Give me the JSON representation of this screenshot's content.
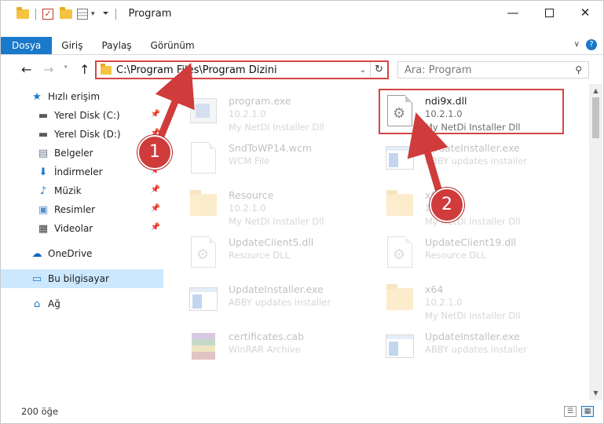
{
  "window": {
    "title": "Program",
    "minimize_glyph": "—",
    "close_glyph": "✕"
  },
  "ribbon": {
    "tabs": [
      "Dosya",
      "Giriş",
      "Paylaş",
      "Görünüm"
    ],
    "help_glyph": "?"
  },
  "nav": {
    "back_glyph": "←",
    "forward_glyph": "→",
    "recent_glyph": "˅",
    "up_glyph": "↑",
    "address_path": "C:\\Program Files\\Program Dizini",
    "refresh_glyph": "↻",
    "search_placeholder": "Ara: Program",
    "search_glyph": "⚲"
  },
  "sidebar": {
    "items": [
      {
        "label": "Hızlı erişim",
        "icon": "star-icon",
        "pinned": false
      },
      {
        "label": "Yerel Disk (C:)",
        "icon": "drive-icon",
        "pinned": true
      },
      {
        "label": "Yerel Disk (D:)",
        "icon": "drive-icon",
        "pinned": true
      },
      {
        "label": "Belgeler",
        "icon": "documents-icon",
        "pinned": true
      },
      {
        "label": "İndirmeler",
        "icon": "download-icon",
        "pinned": true
      },
      {
        "label": "Müzik",
        "icon": "music-icon",
        "pinned": true
      },
      {
        "label": "Resimler",
        "icon": "pictures-icon",
        "pinned": true
      },
      {
        "label": "Videolar",
        "icon": "videos-icon",
        "pinned": true
      },
      {
        "label": "OneDrive",
        "icon": "cloud-icon",
        "pinned": false
      },
      {
        "label": "Bu bilgisayar",
        "icon": "computer-icon",
        "pinned": false
      },
      {
        "label": "Ağ",
        "icon": "network-icon",
        "pinned": false
      }
    ]
  },
  "files": [
    {
      "name": "program.exe",
      "line2": "10.2.1.0",
      "line3": "My NetDi Installer Dll",
      "type": "exe-prog"
    },
    {
      "name": "ndi9x.dll",
      "line2": "10.2.1.0",
      "line3": "My NetDi Installer Dll",
      "type": "dll"
    },
    {
      "name": "SndToWP14.wcm",
      "line2": "WCM File",
      "line3": "",
      "type": "doc"
    },
    {
      "name": "UpdateInstaller.exe",
      "line2": "ABBY updates installer",
      "line3": "",
      "type": "app"
    },
    {
      "name": "Resource",
      "line2": "10.2.1.0",
      "line3": "My NetDi Installer Dll",
      "type": "folder"
    },
    {
      "name": "x64",
      "line2": "10.2.1.0",
      "line3": "My NetDi Installer Dll",
      "type": "folder"
    },
    {
      "name": "UpdateClient5.dll",
      "line2": "Resource DLL",
      "line3": "",
      "type": "dll"
    },
    {
      "name": "UpdateClient19.dll",
      "line2": "Resource DLL",
      "line3": "",
      "type": "dll"
    },
    {
      "name": "UpdateInstaller.exe",
      "line2": "ABBY updates installer",
      "line3": "",
      "type": "app"
    },
    {
      "name": "x64",
      "line2": "10.2.1.0",
      "line3": "My NetDi Installer Dll",
      "type": "folder"
    },
    {
      "name": "certificates.cab",
      "line2": "WinRAR Archive",
      "line3": "",
      "type": "rar"
    },
    {
      "name": "UpdateInstaller.exe",
      "line2": "ABBY updates installer",
      "line3": "",
      "type": "app"
    }
  ],
  "status": {
    "item_count": "200 öğe"
  },
  "callouts": {
    "step1": "1",
    "step2": "2",
    "color": "#d03b3b"
  }
}
